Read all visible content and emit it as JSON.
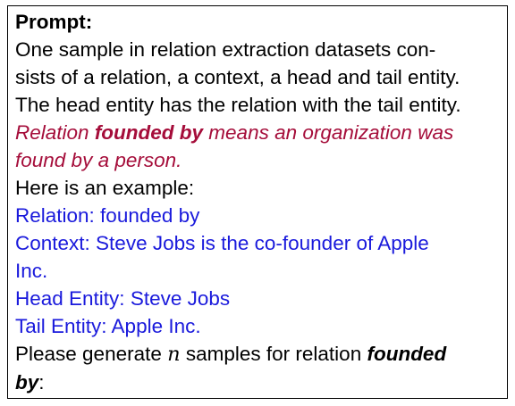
{
  "prompt": {
    "title": "Prompt:",
    "intro_line1": "One sample in relation extraction datasets con-",
    "intro_line2": "sists of a relation, a context, a head and tail entity.",
    "intro_line3": "The head entity has the relation with the tail entity.",
    "definition": {
      "prefix": "Relation ",
      "relation": "founded by",
      "suffix_line1": " means an organization was",
      "suffix_line2": "found by a person."
    },
    "example_intro": "Here is an example:",
    "example": {
      "relation": "Relation: founded by",
      "context_line1": "Context: Steve Jobs is the co-founder of Apple",
      "context_line2": "Inc.",
      "head": "Head Entity: Steve Jobs",
      "tail": "Tail Entity: Apple Inc."
    },
    "request": {
      "before": "Please generate ",
      "variable": "n",
      "middle": " samples for relation ",
      "relation_part1": "founded",
      "relation_part2": "by",
      "end": ":"
    }
  },
  "colors": {
    "definition": "#a50d3a",
    "example": "#1a1adc",
    "text": "#000000",
    "border": "#000000"
  }
}
